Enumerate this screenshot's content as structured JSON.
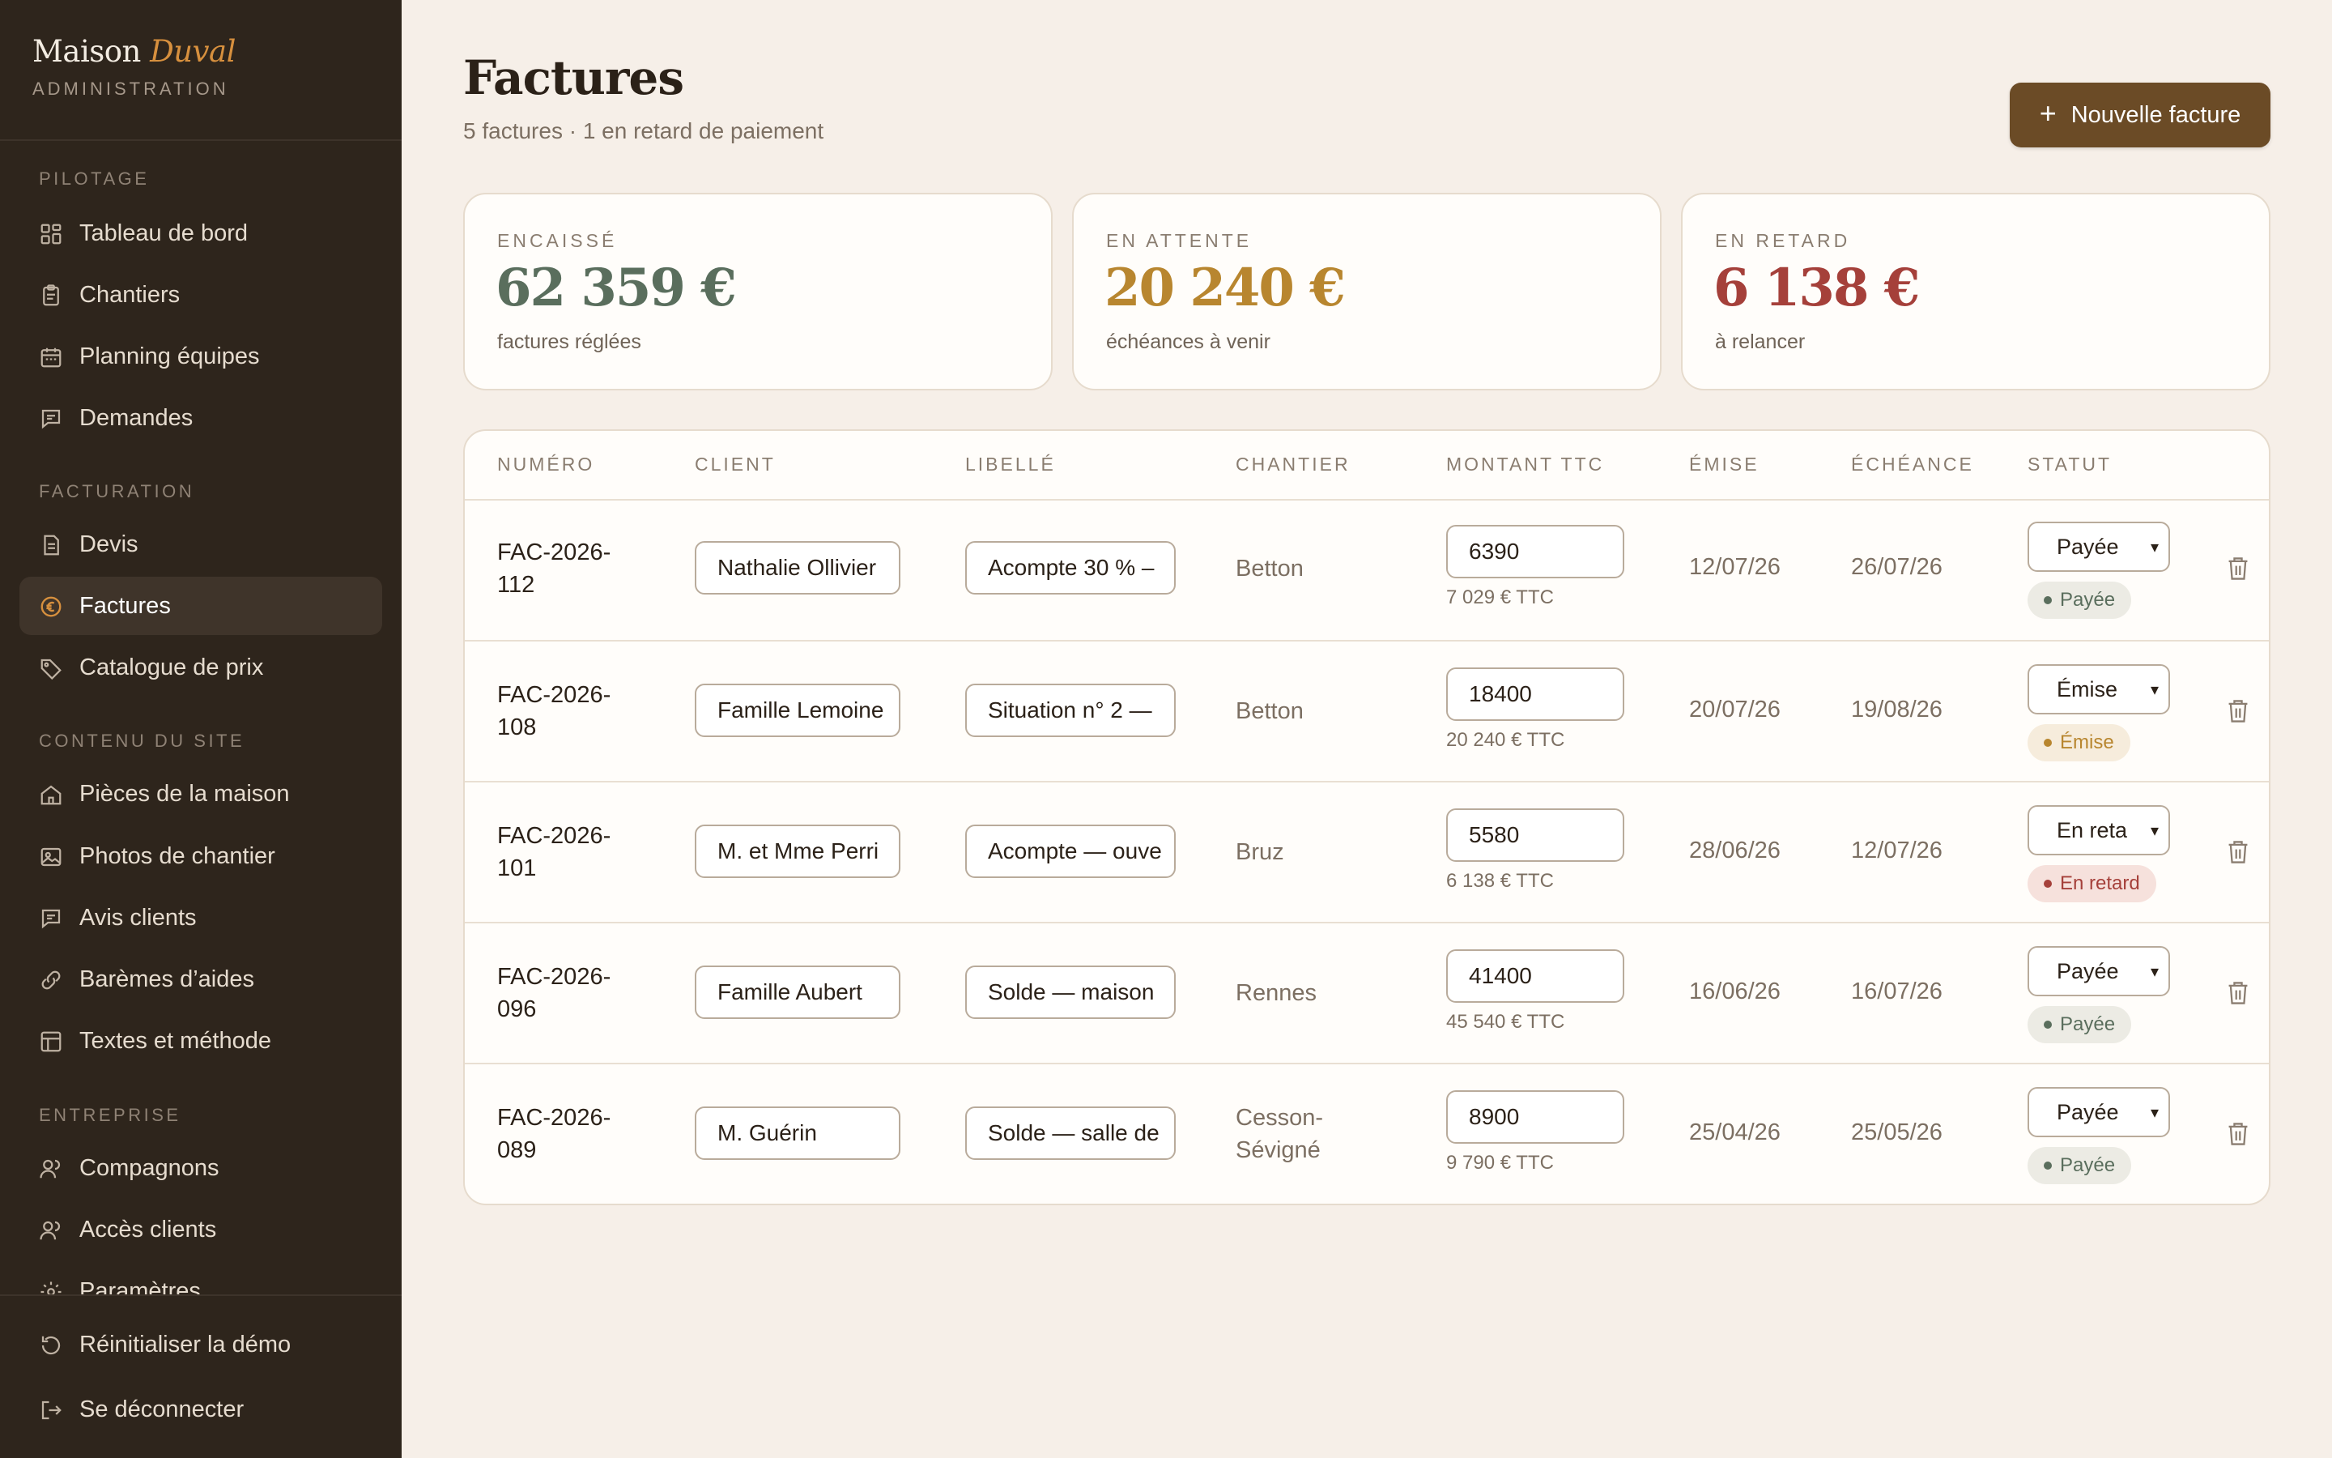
{
  "brand": {
    "name": "Maison",
    "name_accent": "Duval",
    "subtitle": "ADMINISTRATION"
  },
  "sidebar": {
    "sections": [
      {
        "label": "PILOTAGE"
      },
      {
        "label": "FACTURATION"
      },
      {
        "label": "CONTENU DU SITE"
      },
      {
        "label": "ENTREPRISE"
      }
    ],
    "items": [
      {
        "label": "Tableau de bord",
        "icon": "dashboard-icon"
      },
      {
        "label": "Chantiers",
        "icon": "clipboard-icon"
      },
      {
        "label": "Planning équipes",
        "icon": "calendar-icon"
      },
      {
        "label": "Demandes",
        "icon": "message-icon"
      },
      {
        "label": "Devis",
        "icon": "document-icon"
      },
      {
        "label": "Factures",
        "icon": "euro-icon",
        "active": true
      },
      {
        "label": "Catalogue de prix",
        "icon": "tag-icon"
      },
      {
        "label": "Pièces de la maison",
        "icon": "home-icon"
      },
      {
        "label": "Photos de chantier",
        "icon": "image-icon"
      },
      {
        "label": "Avis clients",
        "icon": "message-icon"
      },
      {
        "label": "Barèmes d’aides",
        "icon": "link-icon"
      },
      {
        "label": "Textes et méthode",
        "icon": "layout-icon"
      },
      {
        "label": "Compagnons",
        "icon": "users-icon"
      },
      {
        "label": "Accès clients",
        "icon": "users-icon"
      },
      {
        "label": "Paramètres",
        "icon": "gear-icon"
      }
    ],
    "footer": [
      {
        "label": "Réinitialiser la démo",
        "icon": "reset-icon"
      },
      {
        "label": "Se déconnecter",
        "icon": "logout-icon"
      }
    ]
  },
  "header": {
    "title": "Factures",
    "subtitle": "5 factures · 1 en retard de paiement",
    "new_button": "Nouvelle facture"
  },
  "stats": [
    {
      "label": "ENCAISSÉ",
      "value": "62 359 €",
      "note": "factures réglées",
      "color": "#5a6e5d"
    },
    {
      "label": "EN ATTENTE",
      "value": "20 240 €",
      "note": "échéances à venir",
      "color": "#b8862f"
    },
    {
      "label": "EN RETARD",
      "value": "6 138 €",
      "note": "à relancer",
      "color": "#a5403a"
    }
  ],
  "table": {
    "columns": [
      "NUMÉRO",
      "CLIENT",
      "LIBELLÉ",
      "CHANTIER",
      "MONTANT TTC",
      "ÉMISE",
      "ÉCHÉANCE",
      "STATUT"
    ],
    "rows": [
      {
        "num1": "FAC-2026-",
        "num2": "112",
        "client": "Nathalie Ollivier",
        "libelle": "Acompte 30 % – ",
        "site1": "Betton",
        "site2": "",
        "amount": "6390",
        "ttc": "7 029 € TTC",
        "emise": "12/07/26",
        "echeance": "26/07/26",
        "select": "Payée",
        "badge": "Payée",
        "badge_bg": "#ecebe4",
        "badge_fg": "#5a6e5d"
      },
      {
        "num1": "FAC-2026-",
        "num2": "108",
        "client": "Famille Lemoine",
        "libelle": "Situation n° 2 —",
        "site1": "Betton",
        "site2": "",
        "amount": "18400",
        "ttc": "20 240 € TTC",
        "emise": "20/07/26",
        "echeance": "19/08/26",
        "select": "Émise",
        "badge": "Émise",
        "badge_bg": "#f6ecdc",
        "badge_fg": "#b8862f"
      },
      {
        "num1": "FAC-2026-",
        "num2": "101",
        "client": "M. et Mme Perri",
        "libelle": "Acompte — ouve",
        "site1": "Bruz",
        "site2": "",
        "amount": "5580",
        "ttc": "6 138 € TTC",
        "emise": "28/06/26",
        "echeance": "12/07/26",
        "select": "En reta",
        "badge": "En retard",
        "badge_bg": "#f6e1dc",
        "badge_fg": "#a5403a"
      },
      {
        "num1": "FAC-2026-",
        "num2": "096",
        "client": "Famille Aubert",
        "libelle": "Solde — maison",
        "site1": "Rennes",
        "site2": "",
        "amount": "41400",
        "ttc": "45 540 € TTC",
        "emise": "16/06/26",
        "echeance": "16/07/26",
        "select": "Payée",
        "badge": "Payée",
        "badge_bg": "#ecebe4",
        "badge_fg": "#5a6e5d"
      },
      {
        "num1": "FAC-2026-",
        "num2": "089",
        "client": "M. Guérin",
        "libelle": "Solde — salle de",
        "site1": "Cesson-",
        "site2": "Sévigné",
        "amount": "8900",
        "ttc": "9 790 € TTC",
        "emise": "25/04/26",
        "echeance": "25/05/26",
        "select": "Payée",
        "badge": "Payée",
        "badge_bg": "#ecebe4",
        "badge_fg": "#5a6e5d"
      }
    ]
  }
}
